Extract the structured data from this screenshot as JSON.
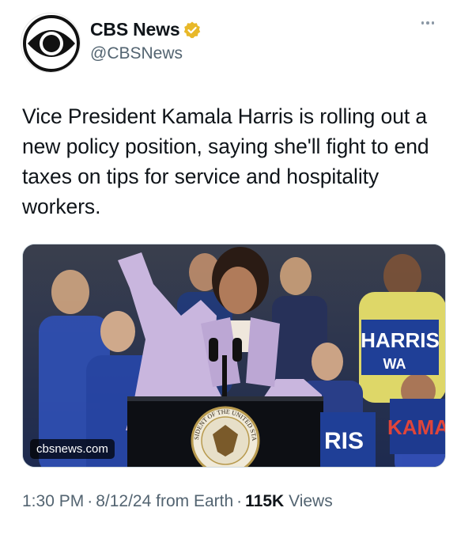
{
  "author": {
    "display_name": "CBS News",
    "handle": "@CBSNews",
    "avatar_icon": "cbs-eye-logo",
    "verified_icon": "verified-badge-icon",
    "verified_color": "#e8b829"
  },
  "tweet": {
    "text": "Vice President Kamala Harris is rolling out a new policy position, saying she'll fight to end taxes on tips for service and hospitality workers."
  },
  "media": {
    "domain_label": "cbsnews.com",
    "podium_seal_text": "PRESIDENT OF THE UNITED STATES",
    "signs": [
      "HARRIS",
      "WA",
      "KAMA",
      "RIS"
    ]
  },
  "meta": {
    "time": "1:30 PM",
    "date": "8/12/24",
    "source": "from Earth",
    "views_count": "115K",
    "views_label": "Views"
  },
  "colors": {
    "text_primary": "#0f1419",
    "text_secondary": "#536471",
    "border": "#cfd9de"
  }
}
